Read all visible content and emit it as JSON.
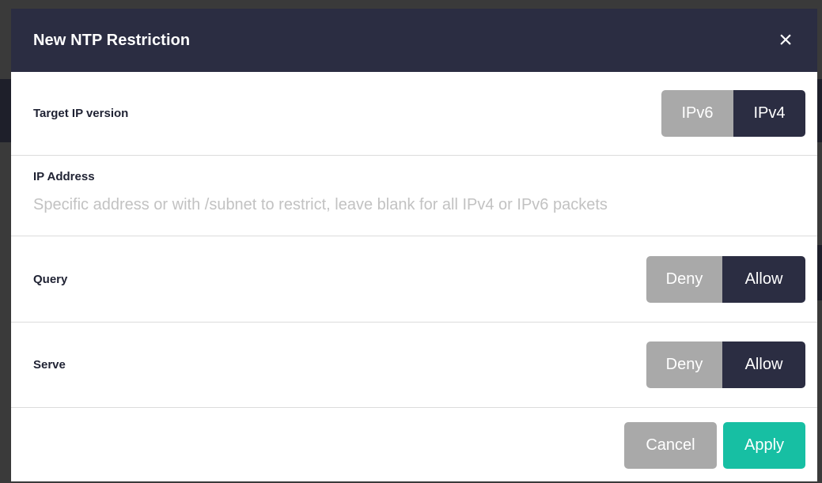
{
  "dialog": {
    "title": "New NTP Restriction",
    "close_glyph": "×"
  },
  "target_ip_version": {
    "label": "Target IP version",
    "options": [
      "IPv6",
      "IPv4"
    ],
    "selected": "IPv4"
  },
  "ip_address": {
    "label": "IP Address",
    "value": "",
    "placeholder": "Specific address or with /subnet to restrict, leave blank for all IPv4 or IPv6 packets"
  },
  "query": {
    "label": "Query",
    "options": [
      "Deny",
      "Allow"
    ],
    "selected": "Allow"
  },
  "serve": {
    "label": "Serve",
    "options": [
      "Deny",
      "Allow"
    ],
    "selected": "Allow"
  },
  "footer": {
    "cancel_label": "Cancel",
    "apply_label": "Apply"
  },
  "colors": {
    "header_bg": "#2b2d42",
    "toggle_on": "#2b2d42",
    "toggle_off": "#a9a9a9",
    "apply": "#17bfa3"
  }
}
